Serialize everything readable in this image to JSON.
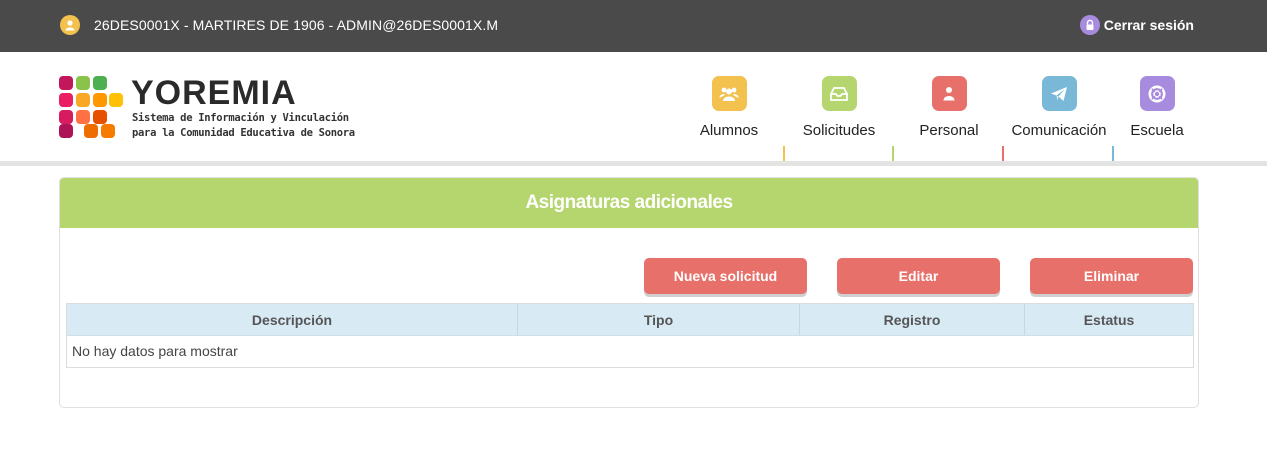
{
  "topbar": {
    "user_text": "26DES0001X - MARTIRES DE 1906 - ADMIN@26DES0001X.M",
    "logout_label": "Cerrar sesión"
  },
  "logo": {
    "title": "YOREMIA",
    "subtitle_line1": "Sistema de Información y Vinculación",
    "subtitle_line2": "para la Comunidad Educativa de Sonora"
  },
  "nav": {
    "items": [
      {
        "label": "Alumnos",
        "icon": "users-icon",
        "color": "#f2c14e"
      },
      {
        "label": "Solicitudes",
        "icon": "inbox-icon",
        "color": "#b5d56f"
      },
      {
        "label": "Personal",
        "icon": "person-icon",
        "color": "#e8706a"
      },
      {
        "label": "Comunicación",
        "icon": "paper-plane-icon",
        "color": "#7ab8d8"
      },
      {
        "label": "Escuela",
        "icon": "lifebuoy-icon",
        "color": "#a78bde"
      }
    ]
  },
  "panel": {
    "title": "Asignaturas adicionales",
    "buttons": {
      "new": "Nueva solicitud",
      "edit": "Editar",
      "delete": "Eliminar"
    },
    "table": {
      "columns": [
        "Descripción",
        "Tipo",
        "Registro",
        "Estatus"
      ],
      "empty_text": "No hay datos para mostrar"
    }
  },
  "colors": {
    "topbar": "#4a4a4a",
    "panel_header": "#b5d56f",
    "button": "#e8706a",
    "table_header": "#d8eaf4"
  }
}
